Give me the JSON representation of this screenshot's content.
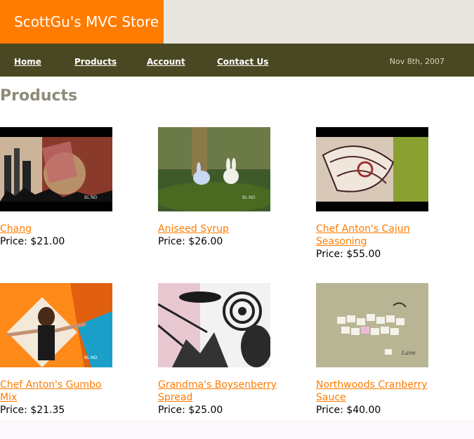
{
  "header": {
    "brand": "ScottGu's MVC Store",
    "nav": [
      {
        "label": "Home"
      },
      {
        "label": "Products"
      },
      {
        "label": "Account"
      },
      {
        "label": "Contact Us"
      }
    ],
    "date": "Nov 8th, 2007"
  },
  "main": {
    "title": "Products",
    "products": [
      {
        "name": "Chang",
        "price_label": "Price:",
        "price": "$21.00"
      },
      {
        "name": "Aniseed Syrup",
        "price_label": "Price:",
        "price": "$26.00"
      },
      {
        "name": "Chef Anton's Cajun Seasoning",
        "price_label": "Price:",
        "price": "$55.00"
      },
      {
        "name": "Chef Anton's Gumbo Mix",
        "price_label": "Price:",
        "price": "$21.35"
      },
      {
        "name": "Grandma's Boysenberry Spread",
        "price_label": "Price:",
        "price": "$25.00"
      },
      {
        "name": "Northwoods Cranberry Sauce",
        "price_label": "Price:",
        "price": "$40.00"
      }
    ]
  },
  "colors": {
    "accent": "#ff7c00",
    "nav_bar": "#4a4822",
    "title": "#8e8c78"
  }
}
